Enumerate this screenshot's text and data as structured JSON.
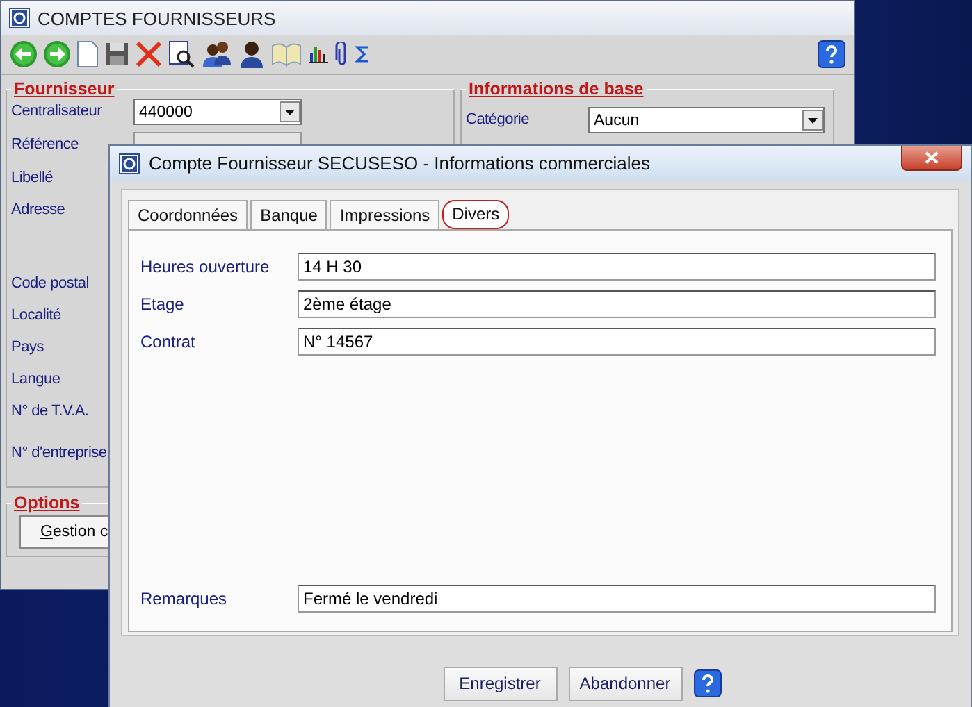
{
  "main_window": {
    "title": "COMPTES FOURNISSEURS",
    "fournisseur": {
      "heading": "Fournisseur",
      "fields": [
        {
          "label": "Centralisateur",
          "kind": "dropdown",
          "value": "440000"
        },
        {
          "label": "Référence",
          "kind": "text"
        },
        {
          "label": "Libellé",
          "kind": "label"
        },
        {
          "label": "Adresse",
          "kind": "address"
        },
        {
          "label": "Code postal",
          "kind": "label"
        },
        {
          "label": "Localité",
          "kind": "label"
        },
        {
          "label": "Pays",
          "kind": "label"
        },
        {
          "label": "Langue",
          "kind": "label"
        },
        {
          "label": "N° de T.V.A.",
          "kind": "tall"
        },
        {
          "label": "N° d'entreprise",
          "kind": "tall"
        }
      ]
    },
    "informations_de_base": {
      "heading": "Informations de base",
      "fields": [
        {
          "label": "Catégorie",
          "kind": "dropdown",
          "value": "Aucun"
        }
      ]
    },
    "options": {
      "heading": "Options",
      "button": "Gestion c"
    }
  },
  "dialog": {
    "title": "Compte Fournisseur  SECUSESO - Informations commerciales",
    "tabs": [
      {
        "label": "Coordonnées",
        "selected": false
      },
      {
        "label": "Banque",
        "selected": false
      },
      {
        "label": "Impressions",
        "selected": false
      },
      {
        "label": "Divers",
        "selected": true
      }
    ],
    "fields": [
      {
        "label": "Heures ouverture",
        "value": "14 H 30"
      },
      {
        "label": "Etage",
        "value": "2ème étage"
      },
      {
        "label": "Contrat",
        "value": "N° 14567"
      }
    ],
    "remarks": {
      "label": "Remarques",
      "value": "Fermé le vendredi"
    },
    "buttons": [
      "Enregistrer",
      "Abandonner"
    ]
  }
}
